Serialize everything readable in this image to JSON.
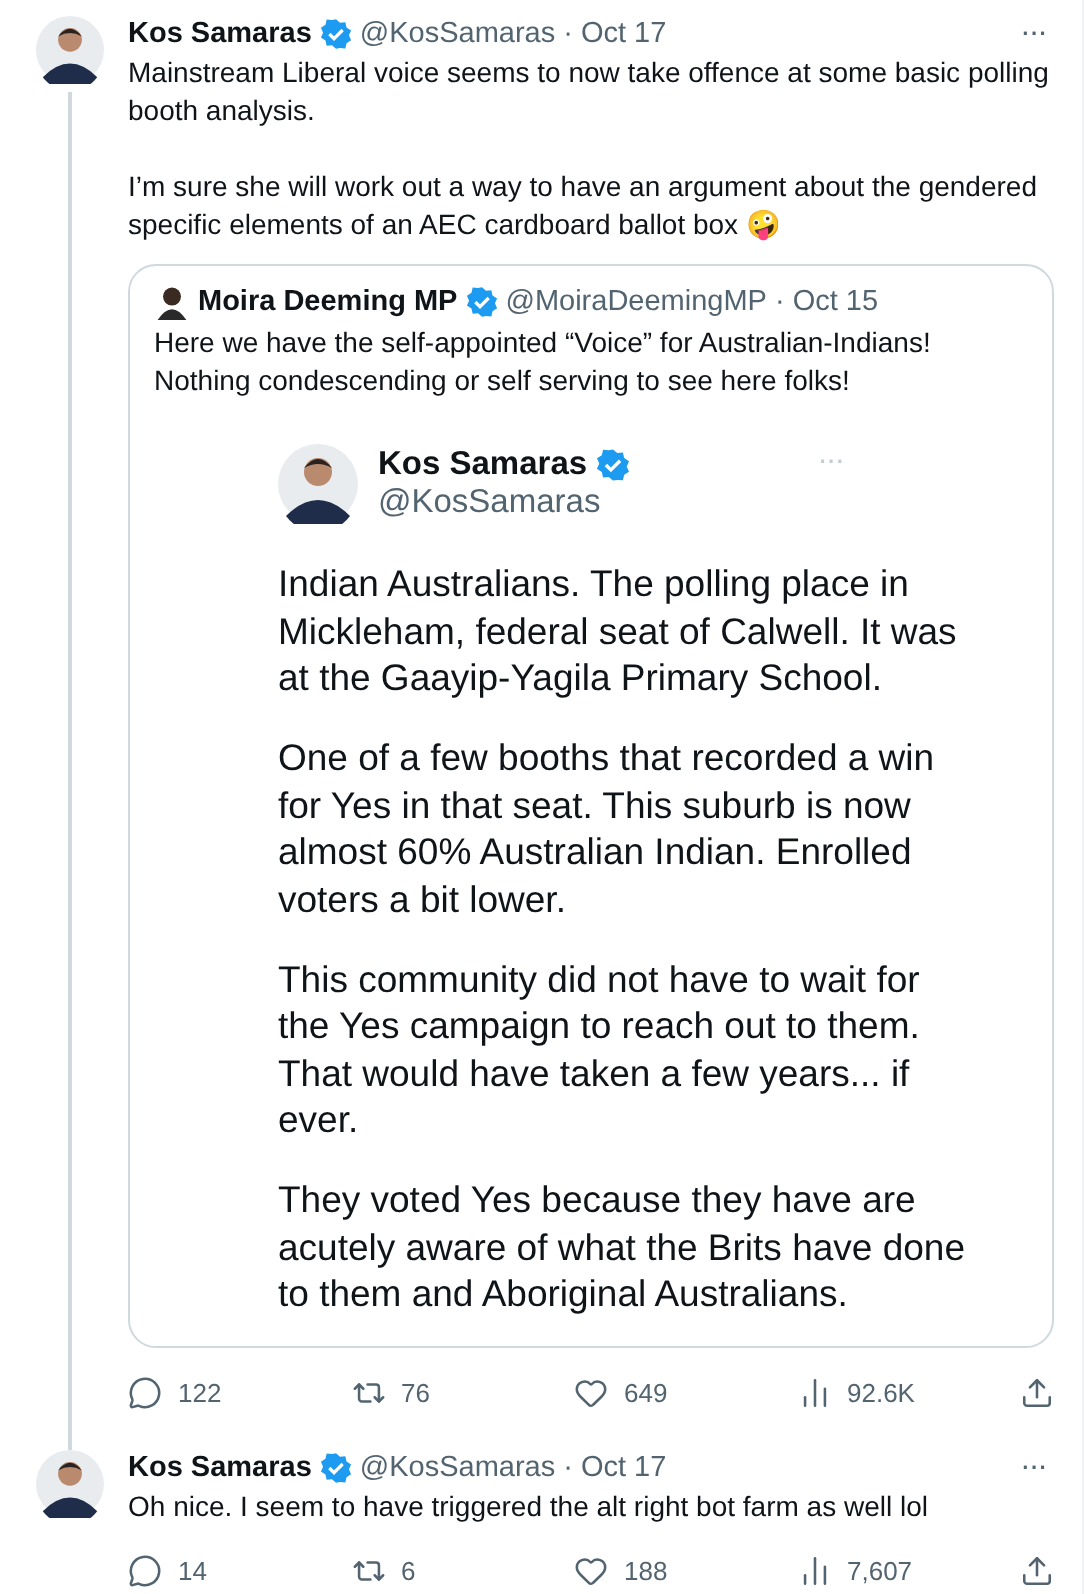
{
  "tweets": [
    {
      "author": "Kos Samaras",
      "handle": "@KosSamaras",
      "dot": "·",
      "date": "Oct 17",
      "verified": true,
      "more": "···",
      "thread_line": true,
      "paragraphs": [
        "Mainstream Liberal voice seems to now take offence at some basic polling booth analysis.",
        "I’m sure she will work out a way to have an argument about the gendered specific elements of an AEC cardboard ballot box 🤪"
      ],
      "quote": {
        "author": "Moira Deeming MP",
        "handle": "@MoiraDeemingMP",
        "dot": "·",
        "date": "Oct 15",
        "verified": true,
        "text": "Here we have the self-appointed “Voice” for Australian-Indians! Nothing condescending or self serving to see here folks!",
        "image": {
          "author": "Kos Samaras",
          "handle": "@KosSamaras",
          "verified": true,
          "more": "···",
          "paragraphs": [
            "Indian Australians. The polling place in Mickleham, federal seat of Calwell. It was at the Gaayip-Yagila Primary School.",
            "One of a few booths that recorded a win for Yes in that seat. This suburb is now almost 60% Australian Indian. Enrolled voters a bit lower.",
            "This community did not have to wait for the Yes campaign to reach out to them. That would have taken a few years... if ever.",
            "They voted Yes because they have are acutely aware of what the Brits have done to them and Aboriginal Australians."
          ]
        }
      },
      "stats": [
        {
          "kind": "reply",
          "count": "122"
        },
        {
          "kind": "repost",
          "count": "76"
        },
        {
          "kind": "like",
          "count": "649"
        },
        {
          "kind": "views",
          "count": "92.6K"
        },
        {
          "kind": "share"
        }
      ]
    },
    {
      "author": "Kos Samaras",
      "handle": "@KosSamaras",
      "dot": "·",
      "date": "Oct 17",
      "verified": true,
      "more": "···",
      "thread_line": false,
      "paragraphs": [
        "Oh nice. I seem to have triggered the alt right bot farm as well lol"
      ],
      "stats": [
        {
          "kind": "reply",
          "count": "14"
        },
        {
          "kind": "repost",
          "count": "6"
        },
        {
          "kind": "like",
          "count": "188"
        },
        {
          "kind": "views",
          "count": "7,607"
        },
        {
          "kind": "share"
        }
      ]
    }
  ]
}
